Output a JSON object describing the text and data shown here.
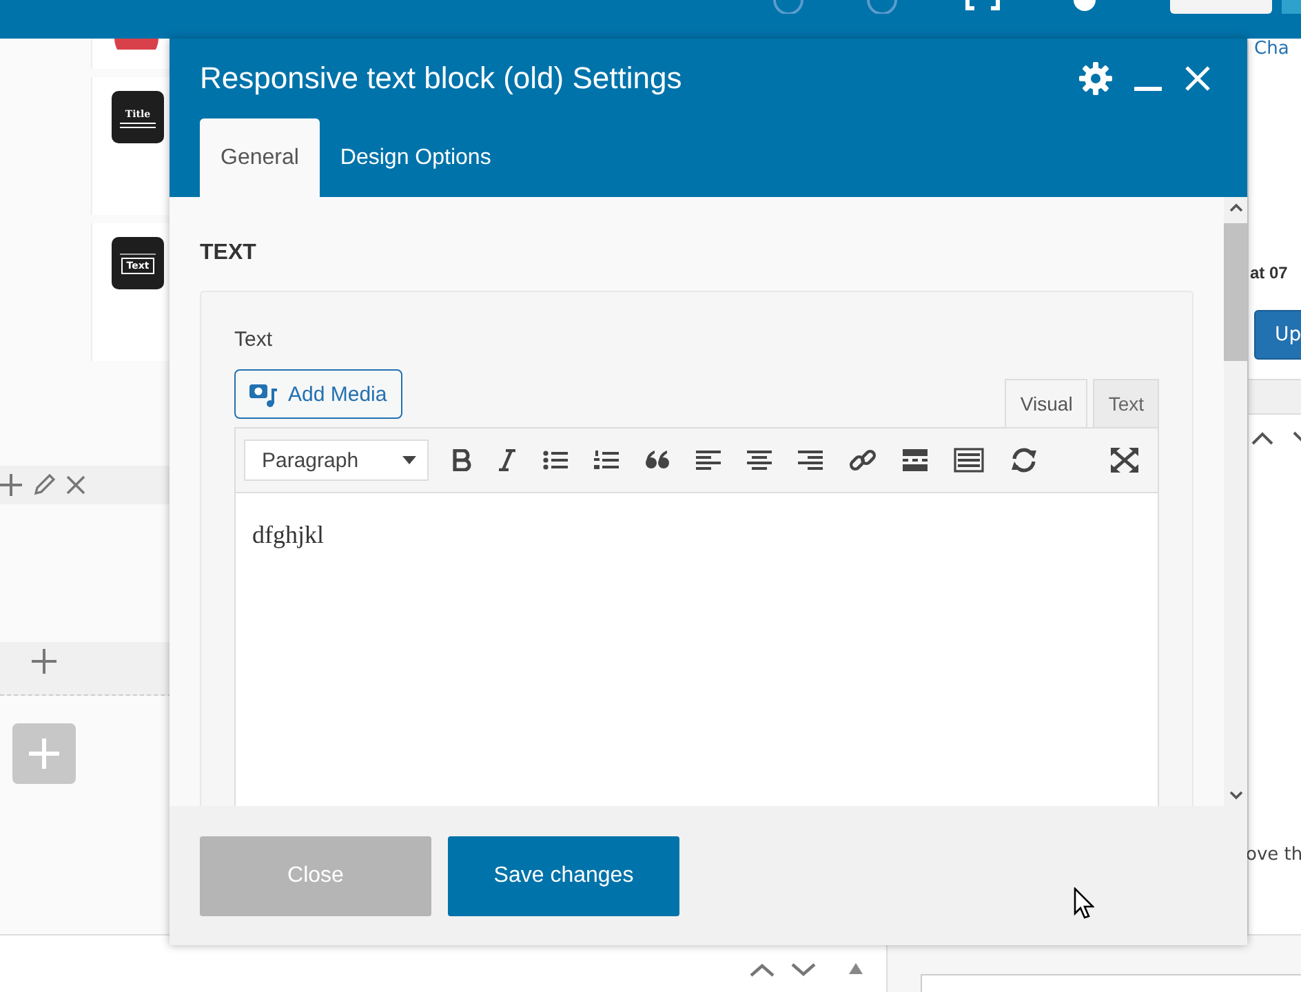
{
  "background": {
    "top_link": "Cha",
    "publish_time": "at 07",
    "update_button": "Up",
    "side_text": "ove th",
    "elements": [
      {
        "kind": "title",
        "label": "Title"
      },
      {
        "kind": "text",
        "label": "Text"
      }
    ]
  },
  "dialog": {
    "title": "Responsive text block (old) Settings",
    "tabs": [
      {
        "label": "General",
        "selected": true
      },
      {
        "label": "Design Options",
        "selected": false
      }
    ],
    "section": "TEXT",
    "field_label": "Text",
    "add_media": "Add Media",
    "editor_tabs": [
      {
        "label": "Visual",
        "selected": true
      },
      {
        "label": "Text",
        "selected": false
      }
    ],
    "format": "Paragraph",
    "content": "dfghjkl",
    "buttons": [
      {
        "kind": "secondary",
        "label": "Close"
      },
      {
        "kind": "primary",
        "label": "Save changes"
      }
    ]
  }
}
